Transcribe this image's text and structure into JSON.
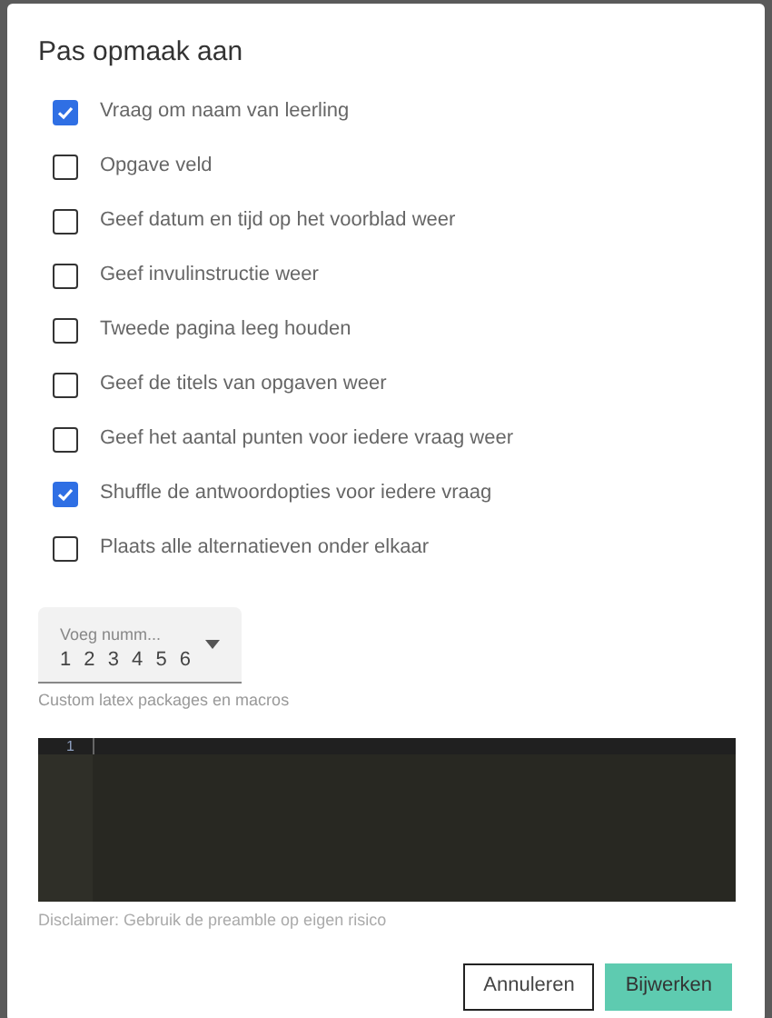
{
  "dialog": {
    "title": "Pas opmaak aan"
  },
  "options": [
    {
      "label": "Vraag om naam van leerling",
      "checked": true
    },
    {
      "label": "Opgave veld",
      "checked": false
    },
    {
      "label": "Geef datum en tijd op het voorblad weer",
      "checked": false
    },
    {
      "label": "Geef invulinstructie weer",
      "checked": false
    },
    {
      "label": "Tweede pagina leeg houden",
      "checked": false
    },
    {
      "label": "Geef de titels van opgaven weer",
      "checked": false
    },
    {
      "label": "Geef het aantal punten voor iedere vraag weer",
      "checked": false
    },
    {
      "label": "Shuffle de antwoordopties voor iedere vraag",
      "checked": true
    },
    {
      "label": "Plaats alle alternatieven onder elkaar",
      "checked": false
    }
  ],
  "numbering_select": {
    "label": "Voeg numm...",
    "value": "1 2 3 4 5 6"
  },
  "preamble": {
    "label": "Custom latex packages en macros",
    "line_numbers": [
      "1"
    ],
    "disclaimer": "Disclaimer: Gebruik de preamble op eigen risico"
  },
  "buttons": [
    {
      "label": "Annuleren",
      "kind": "outline"
    },
    {
      "label": "Bijwerken",
      "kind": "primary"
    }
  ]
}
